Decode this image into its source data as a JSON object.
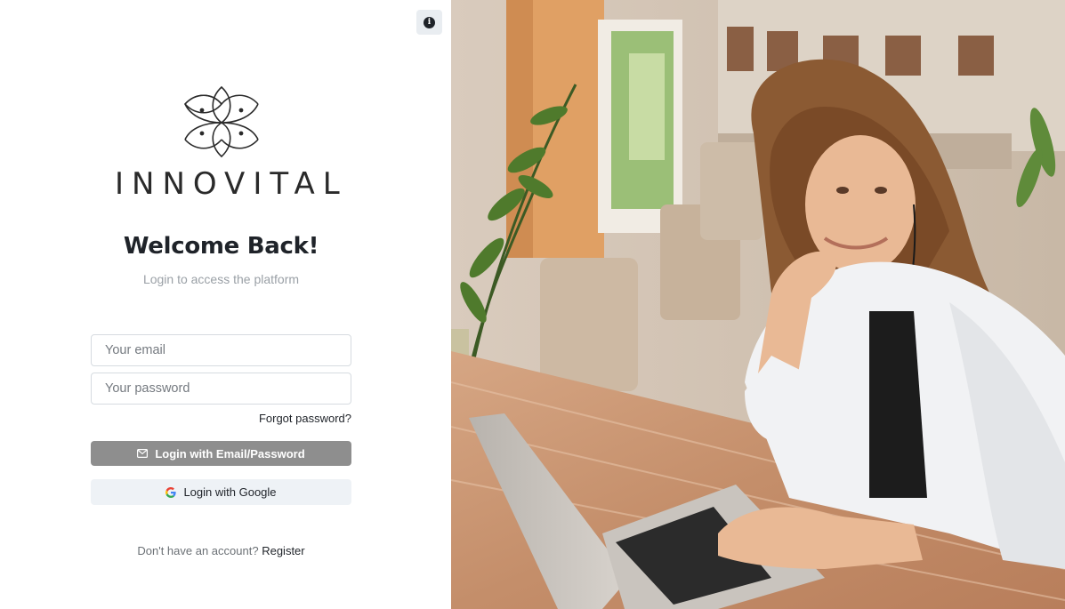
{
  "header": {
    "info_icon": "info-icon"
  },
  "brand": {
    "logo_icon": "lotus-logo-icon",
    "name": "INNOVITAL"
  },
  "login": {
    "title": "Welcome Back!",
    "subtitle": "Login to access the platform",
    "email_placeholder": "Your email",
    "password_placeholder": "Your password",
    "forgot_password": "Forgot password?",
    "email_button": {
      "label": "Login with Email/Password",
      "icon": "mail-icon"
    },
    "google_button": {
      "label": "Login with Google",
      "icon": "google-icon"
    },
    "register_prompt": "Don't have an account?",
    "register_link": "Register"
  },
  "colors": {
    "primary_button": "#8e8e8e",
    "secondary_button": "#eef2f6",
    "text": "#1f2329",
    "muted_text": "#9aa0a6"
  }
}
